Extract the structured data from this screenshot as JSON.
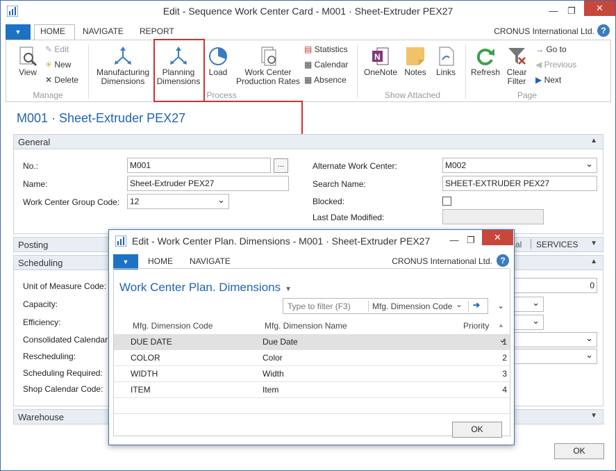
{
  "window": {
    "title": "Edit - Sequence Work Center Card - M001 · Sheet-Extruder PEX27",
    "minimize": "—",
    "restore": "❐",
    "close": "✕"
  },
  "tabs": {
    "home": "HOME",
    "navigate": "NAVIGATE",
    "report": "REPORT"
  },
  "company": "CRONUS International Ltd.",
  "ribbon": {
    "manage": {
      "label": "Manage",
      "view": "View",
      "edit": "Edit",
      "new": "New",
      "delete": "Delete"
    },
    "process": {
      "label": "Process",
      "mfg_dims": "Manufacturing Dimensions",
      "planning_dims": "Planning Dimensions",
      "load": "Load",
      "wc_rates": "Work Center Production Rates",
      "statistics": "Statistics",
      "calendar": "Calendar",
      "absence": "Absence"
    },
    "show_attached": {
      "label": "Show Attached",
      "onenote": "OneNote",
      "notes": "Notes",
      "links": "Links"
    },
    "page": {
      "label": "Page",
      "refresh": "Refresh",
      "clear_filter": "Clear Filter",
      "goto": "Go to",
      "previous": "Previous",
      "next": "Next"
    }
  },
  "page_title": "M001 · Sheet-Extruder PEX27",
  "general": {
    "header": "General",
    "no_label": "No.:",
    "no_value": "M001",
    "name_label": "Name:",
    "name_value": "Sheet-Extruder PEX27",
    "group_label": "Work Center Group Code:",
    "group_value": "12",
    "alt_label": "Alternate Work Center:",
    "alt_value": "M002",
    "search_label": "Search Name:",
    "search_value": "SHEET-EXTRUDER PEX27",
    "blocked_label": "Blocked:",
    "modified_label": "Last Date Modified:",
    "modified_value": ""
  },
  "posting": {
    "header": "Posting",
    "tag1": "al",
    "tag2": "SERVICES"
  },
  "scheduling": {
    "header": "Scheduling",
    "uom_label": "Unit of Measure Code:",
    "capacity_label": "Capacity:",
    "efficiency_label": "Efficiency:",
    "consolidated_label": "Consolidated Calendar:",
    "rescheduling_label": "Rescheduling:",
    "sched_req_label": "Scheduling Required:",
    "shop_cal_label": "Shop Calendar Code:",
    "uom_value_right": "0"
  },
  "warehouse": {
    "header": "Warehouse"
  },
  "ok": "OK",
  "dialog": {
    "title": "Edit - Work Center Plan. Dimensions - M001 · Sheet-Extruder PEX27",
    "tab_home": "HOME",
    "tab_navigate": "NAVIGATE",
    "company": "CRONUS International Ltd.",
    "heading": "Work Center Plan. Dimensions",
    "filter_placeholder": "Type to filter (F3)",
    "filter_field": "Mfg. Dimension Code",
    "columns": {
      "code": "Mfg. Dimension Code",
      "name": "Mfg. Dimension Name",
      "priority": "Priority"
    },
    "rows": [
      {
        "code": "DUE DATE",
        "name": "Due Date",
        "priority": "1"
      },
      {
        "code": "COLOR",
        "name": "Color",
        "priority": "2"
      },
      {
        "code": "WIDTH",
        "name": "Width",
        "priority": "3"
      },
      {
        "code": "ITEM",
        "name": "Item",
        "priority": "4"
      }
    ],
    "ok": "OK"
  }
}
